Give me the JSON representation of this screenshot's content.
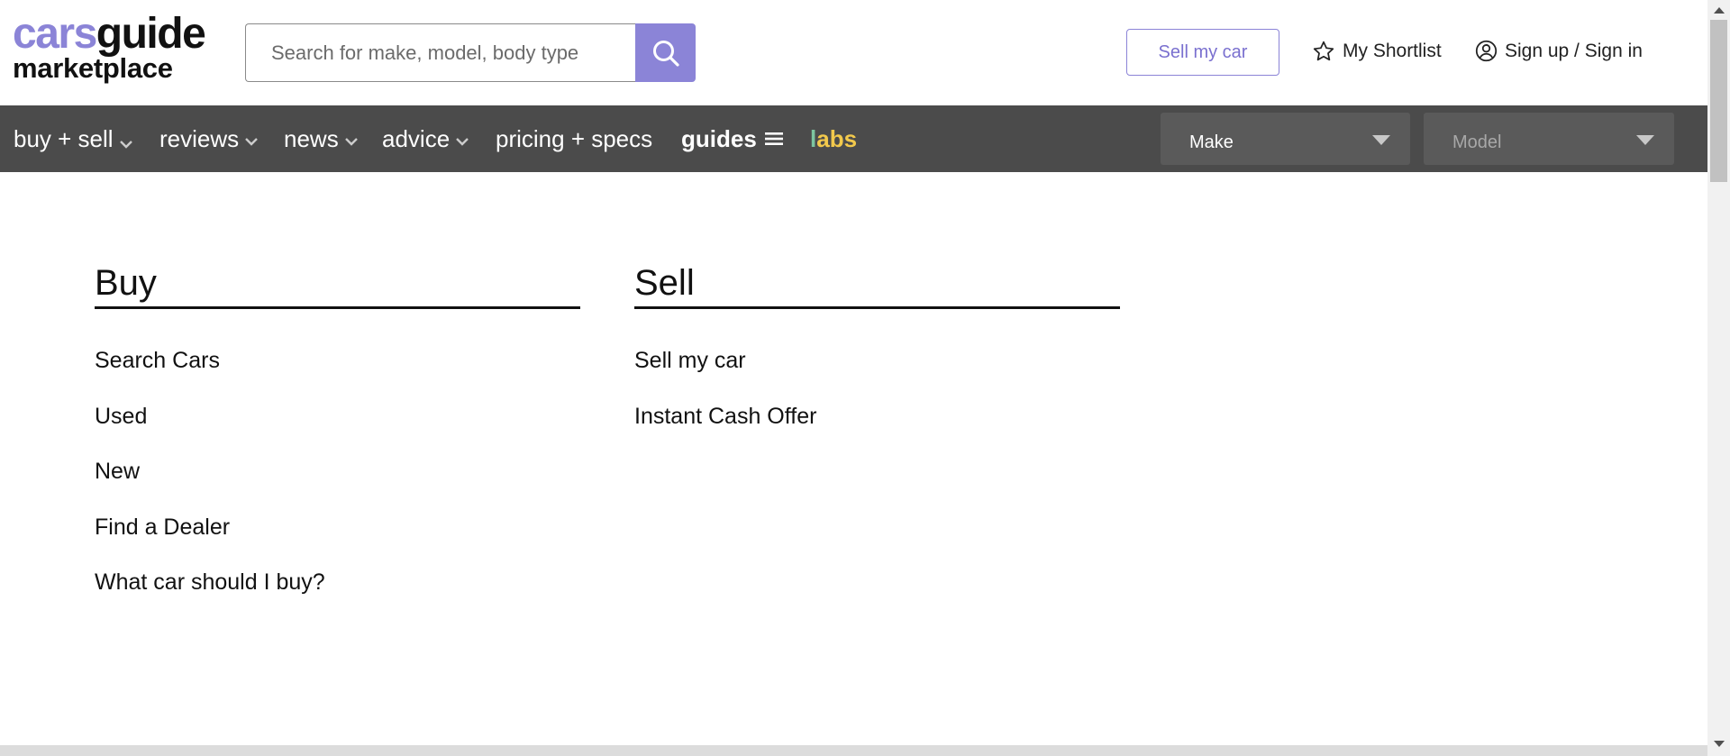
{
  "header": {
    "logo": {
      "part1": "cars",
      "part2": "guide",
      "line2": "marketplace"
    },
    "search": {
      "placeholder": "Search for make, model, body type",
      "value": ""
    },
    "sell_button": "Sell my car",
    "shortlist": "My Shortlist",
    "signin": "Sign up / Sign in"
  },
  "nav": {
    "items": [
      "buy + sell",
      "reviews",
      "news",
      "advice",
      "pricing + specs",
      "guides"
    ],
    "labs": {
      "first": "l",
      "rest": "abs"
    },
    "make_select": "Make",
    "model_select": "Model"
  },
  "menu": {
    "buy": {
      "heading": "Buy",
      "links": [
        "Search Cars",
        "Used",
        "New",
        "Find a Dealer",
        "What car should I buy?"
      ]
    },
    "sell": {
      "heading": "Sell",
      "links": [
        "Sell my car",
        "Instant Cash Offer"
      ]
    }
  },
  "colors": {
    "accent": "#8b84d7",
    "navbar": "#4b4b4b"
  }
}
